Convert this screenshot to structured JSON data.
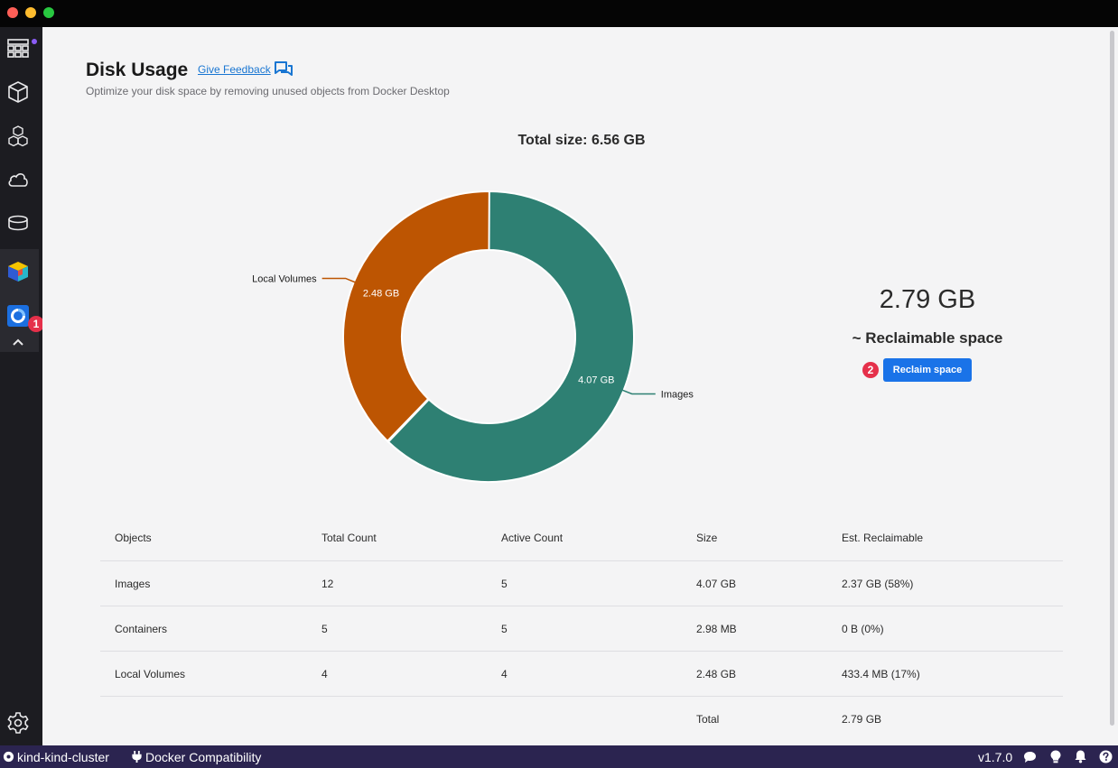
{
  "colors": {
    "images": "#2e8073",
    "local_volumes": "#bd5502",
    "accent": "#1a73e8",
    "badge": "#e5304a",
    "statusbar": "#2b2450"
  },
  "sidebar": {
    "icons": [
      "dashboard-icon",
      "containers-icon",
      "images-icon",
      "cloud-icon",
      "volumes-icon",
      "extension-cube-icon",
      "extension-disk-usage-icon",
      "collapse-chevron-icon",
      "settings-icon"
    ],
    "badge_1": "1"
  },
  "header": {
    "title": "Disk Usage",
    "feedback_label": "Give Feedback",
    "subtitle": "Optimize your disk space by removing unused objects from Docker Desktop"
  },
  "chart_data": {
    "type": "pie",
    "donut": true,
    "title": "Total size: 6.56 GB",
    "slices": [
      {
        "name": "Images",
        "value": 4.07,
        "label": "4.07 GB",
        "color": "#2e8073"
      },
      {
        "name": "Containers",
        "value": 0.00298,
        "label": "",
        "color": "#2c9cff"
      },
      {
        "name": "Local Volumes",
        "value": 2.48,
        "label": "2.48 GB",
        "color": "#bd5502"
      }
    ]
  },
  "reclaim": {
    "amount": "2.79 GB",
    "label": "~ Reclaimable space",
    "button": "Reclaim space",
    "badge_2": "2"
  },
  "table": {
    "headers": [
      "Objects",
      "Total Count",
      "Active Count",
      "Size",
      "Est. Reclaimable"
    ],
    "rows": [
      [
        "Images",
        "12",
        "5",
        "4.07 GB",
        "2.37 GB (58%)"
      ],
      [
        "Containers",
        "5",
        "5",
        "2.98 MB",
        "0 B (0%)"
      ],
      [
        "Local Volumes",
        "4",
        "4",
        "2.48 GB",
        "433.4 MB (17%)"
      ]
    ],
    "total_label": "Total",
    "total_value": "2.79 GB"
  },
  "statusbar": {
    "context": "kind-kind-cluster",
    "compat": "Docker Compatibility",
    "version": "v1.7.0"
  }
}
